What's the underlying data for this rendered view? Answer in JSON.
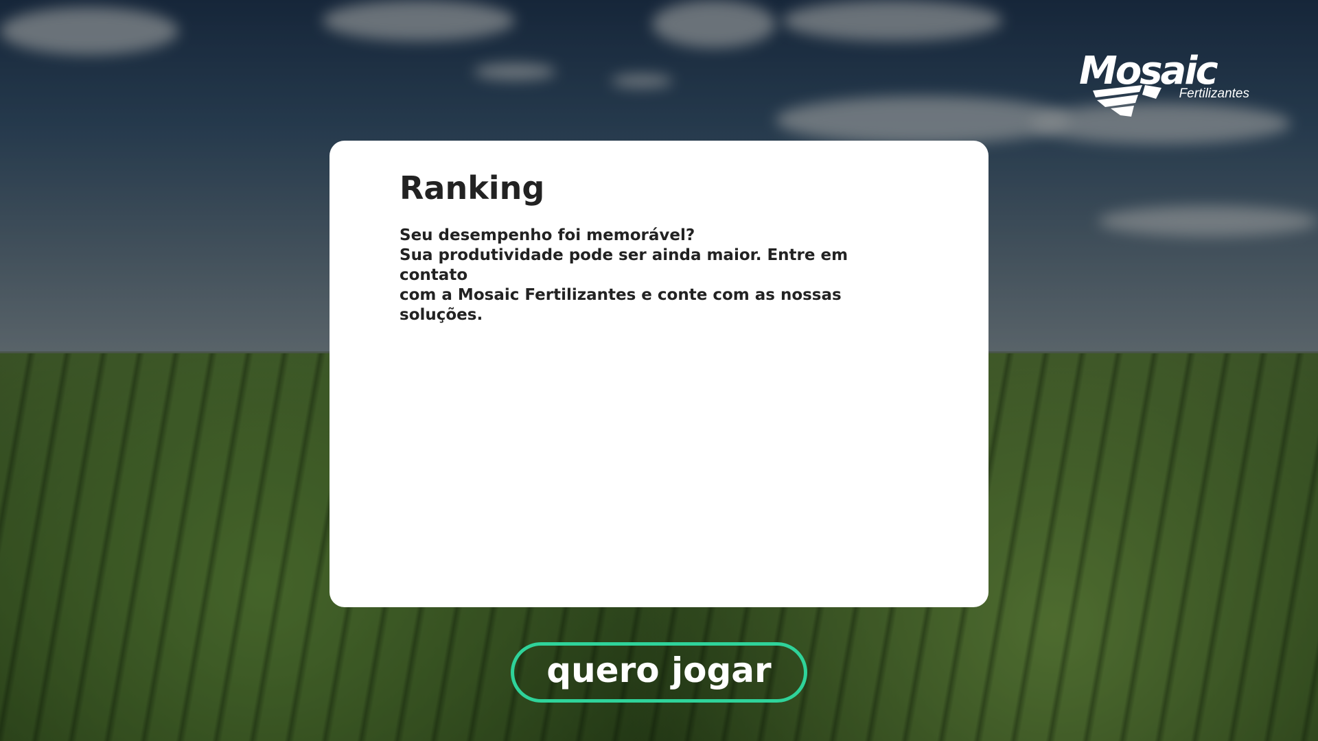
{
  "brand": {
    "name": "Mosaic",
    "subtitle": "Fertilizantes",
    "registered": "®"
  },
  "card": {
    "title": "Ranking",
    "line1": "Seu desempenho foi memorável?",
    "line2": "Sua produtividade pode ser ainda maior. Entre em contato",
    "line3": "com a Mosaic Fertilizantes e conte com as nossas soluções."
  },
  "actions": {
    "play_label": "quero jogar"
  },
  "colors": {
    "button_border": "#2fd39a",
    "card_bg": "#ffffff",
    "text": "#222222"
  }
}
